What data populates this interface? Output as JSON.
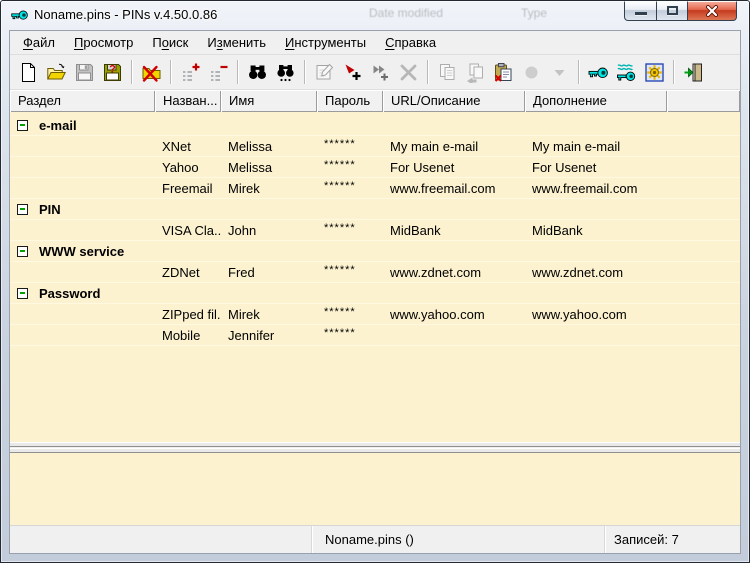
{
  "window": {
    "title": "Noname.pins - PINs v.4.50.0.86"
  },
  "titlebar": {
    "ghost_texts": {
      "left": "Date modified",
      "right": "Type"
    },
    "buttons": [
      "minimize",
      "maximize",
      "close"
    ]
  },
  "menubar": {
    "items": [
      {
        "label": "Файл",
        "accel": 0
      },
      {
        "label": "Просмотр",
        "accel": 0
      },
      {
        "label": "Поиск",
        "accel": 1
      },
      {
        "label": "Изменить",
        "accel": 1
      },
      {
        "label": "Инструменты",
        "accel": 0
      },
      {
        "label": "Справка",
        "accel": 0
      }
    ]
  },
  "toolbar": {
    "buttons": [
      {
        "icon": "new-file-icon",
        "enabled": true
      },
      {
        "icon": "open-file-icon",
        "enabled": true
      },
      {
        "icon": "save-file-icon",
        "enabled": false
      },
      {
        "icon": "save-as-icon",
        "enabled": true
      },
      {
        "type": "separator"
      },
      {
        "icon": "close-file-icon",
        "enabled": true
      },
      {
        "type": "separator"
      },
      {
        "icon": "add-category-icon",
        "enabled": true
      },
      {
        "icon": "remove-category-icon",
        "enabled": true
      },
      {
        "type": "separator"
      },
      {
        "icon": "find-icon",
        "enabled": true
      },
      {
        "icon": "find-next-icon",
        "enabled": true
      },
      {
        "type": "separator"
      },
      {
        "icon": "edit-item-icon",
        "enabled": false
      },
      {
        "icon": "add-item-icon",
        "enabled": true
      },
      {
        "icon": "add-subitem-icon",
        "enabled": false
      },
      {
        "icon": "delete-item-icon",
        "enabled": false
      },
      {
        "type": "separator"
      },
      {
        "icon": "copy-item-icon",
        "enabled": false
      },
      {
        "icon": "copy-clipboard-icon",
        "enabled": false
      },
      {
        "icon": "paste-special-icon",
        "enabled": true
      },
      {
        "icon": "record-icon",
        "enabled": false
      },
      {
        "icon": "dropdown-arrow-icon",
        "enabled": false
      },
      {
        "type": "separator"
      },
      {
        "icon": "generate-password-icon",
        "enabled": true
      },
      {
        "icon": "password-list-icon",
        "enabled": true
      },
      {
        "icon": "options-icon",
        "enabled": true
      },
      {
        "type": "separator"
      },
      {
        "icon": "exit-icon",
        "enabled": true
      }
    ]
  },
  "list": {
    "columns": [
      "Раздел",
      "Назван...",
      "Имя",
      "Пароль",
      "URL/Описание",
      "Дополнение",
      ""
    ],
    "rows": [
      {
        "type": "category",
        "label": "e-mail",
        "expanded": true
      },
      {
        "type": "entry",
        "name": "XNet",
        "login": "Melissa",
        "password": "******",
        "url": "My main e-mail",
        "notes": "My main e-mail"
      },
      {
        "type": "entry",
        "name": "Yahoo",
        "login": "Melissa",
        "password": "******",
        "url": "For Usenet",
        "notes": "For Usenet"
      },
      {
        "type": "entry",
        "name": "Freemail",
        "login": "Mirek",
        "password": "******",
        "url": "www.freemail.com",
        "notes": "www.freemail.com"
      },
      {
        "type": "category",
        "label": "PIN",
        "expanded": true
      },
      {
        "type": "entry",
        "name": "VISA Cla...",
        "login": "John",
        "password": "******",
        "url": "MidBank",
        "notes": "MidBank"
      },
      {
        "type": "category",
        "label": "WWW service",
        "expanded": true
      },
      {
        "type": "entry",
        "name": "ZDNet",
        "login": "Fred",
        "password": "******",
        "url": "www.zdnet.com",
        "notes": "www.zdnet.com"
      },
      {
        "type": "category",
        "label": "Password",
        "expanded": true
      },
      {
        "type": "entry",
        "name": "ZIPped fil...",
        "login": "Mirek",
        "password": "******",
        "url": "www.yahoo.com",
        "notes": "www.yahoo.com"
      },
      {
        "type": "entry",
        "name": "Mobile",
        "login": "Jennifer",
        "password": "******",
        "url": "",
        "notes": ""
      }
    ]
  },
  "statusbar": {
    "left": "",
    "file": "Noname.pins ()",
    "records": "Записей: 7"
  },
  "colors": {
    "list_bg": "#FCF2CF",
    "chrome_bg": "#F0F0F0",
    "close_red": "#CC3A1B",
    "key_cyan": "#00E5E5"
  }
}
